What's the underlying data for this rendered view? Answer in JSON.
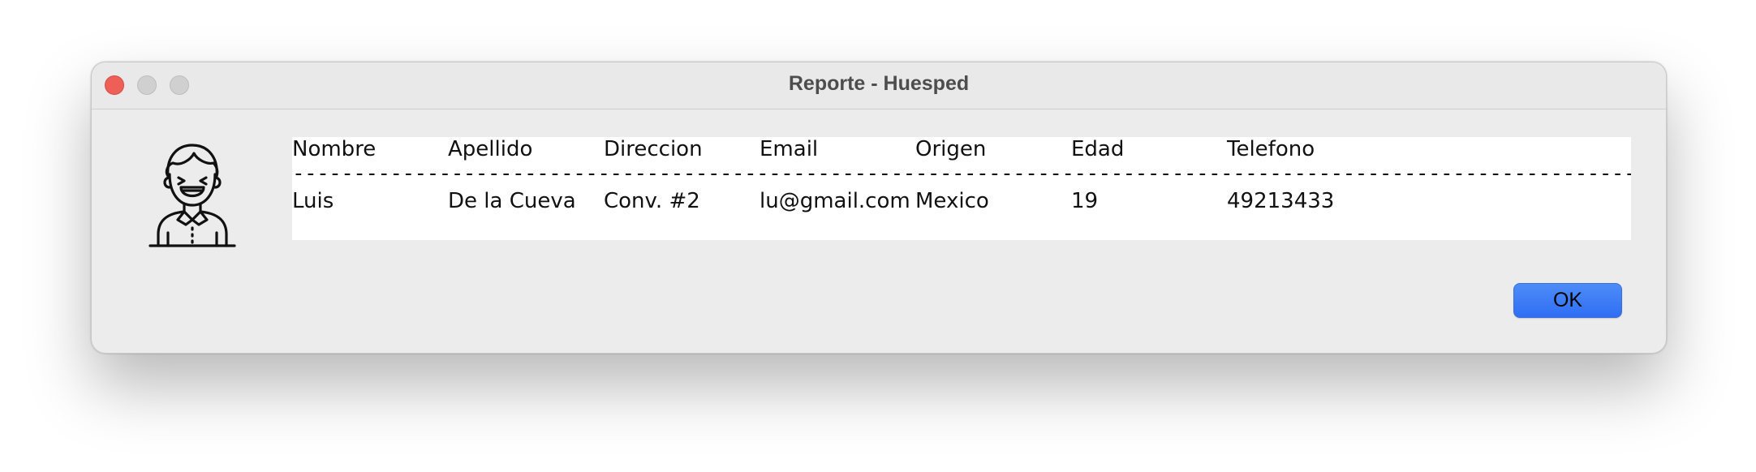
{
  "window": {
    "title": "Reporte - Huesped"
  },
  "avatar": {
    "icon": "smiling-person-icon"
  },
  "report": {
    "columns": [
      "Nombre",
      "Apellido",
      "Direccion",
      "Email",
      "Origen",
      "Edad",
      "Telefono"
    ],
    "divider": "----------------------------------------------------------------------------------------------------------------------------------",
    "rows": [
      [
        "Luis",
        "De la Cueva",
        "Conv. #2",
        "lu@gmail.com",
        "Mexico",
        "19",
        "49213433"
      ]
    ]
  },
  "actions": {
    "ok_label": "OK"
  },
  "colors": {
    "close": "#ee5f57",
    "button": "#2f6ef3",
    "window_bg": "#ececec"
  }
}
